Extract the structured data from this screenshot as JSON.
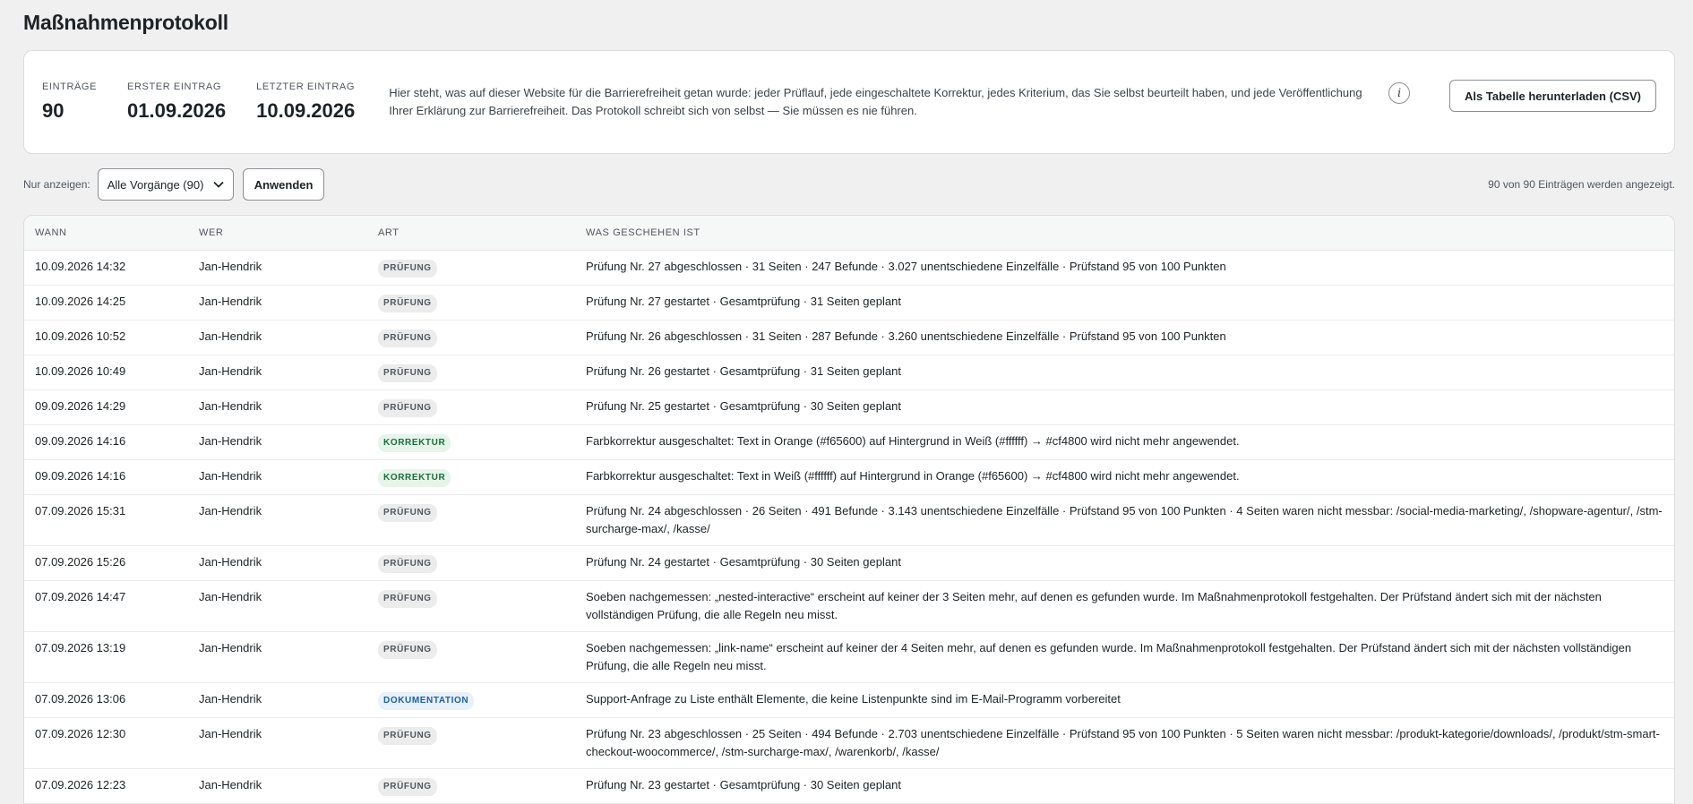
{
  "page": {
    "title": "Maßnahmenprotokoll"
  },
  "summary": {
    "stats": [
      {
        "label": "EINTRÄGE",
        "value": "90"
      },
      {
        "label": "ERSTER EINTRAG",
        "value": "01.09.2026"
      },
      {
        "label": "LETZTER EINTRAG",
        "value": "10.09.2026"
      }
    ],
    "intro": "Hier steht, was auf dieser Website für die Barrierefreiheit getan wurde: jeder Prüflauf, jede eingeschaltete Korrektur, jedes Kriterium, das Sie selbst beurteilt haben, und jede Veröffentlichung Ihrer Erklärung zur Barrierefreiheit. Das Protokoll schreibt sich von selbst — Sie müssen es nie führen.",
    "info_icon": "i",
    "csv_button": "Als Tabelle herunterladen (CSV)"
  },
  "filter": {
    "label": "Nur anzeigen:",
    "selected": "Alle Vorgänge (90)",
    "apply": "Anwenden",
    "count_note": "90 von 90 Einträgen werden angezeigt."
  },
  "table": {
    "headers": [
      "WANN",
      "WER",
      "ART",
      "WAS GESCHEHEN IST"
    ],
    "rows": [
      {
        "when": "10.09.2026 14:32",
        "who": "Jan-Hendrik",
        "type": "PRÜFUNG",
        "kind": "pruefung",
        "what": "Prüfung Nr. 27 abgeschlossen · 31 Seiten · 247 Befunde · 3.027 unentschiedene Einzelfälle · Prüfstand 95 von 100 Punkten"
      },
      {
        "when": "10.09.2026 14:25",
        "who": "Jan-Hendrik",
        "type": "PRÜFUNG",
        "kind": "pruefung",
        "what": "Prüfung Nr. 27 gestartet · Gesamtprüfung · 31 Seiten geplant"
      },
      {
        "when": "10.09.2026 10:52",
        "who": "Jan-Hendrik",
        "type": "PRÜFUNG",
        "kind": "pruefung",
        "what": "Prüfung Nr. 26 abgeschlossen · 31 Seiten · 287 Befunde · 3.260 unentschiedene Einzelfälle · Prüfstand 95 von 100 Punkten"
      },
      {
        "when": "10.09.2026 10:49",
        "who": "Jan-Hendrik",
        "type": "PRÜFUNG",
        "kind": "pruefung",
        "what": "Prüfung Nr. 26 gestartet · Gesamtprüfung · 31 Seiten geplant"
      },
      {
        "when": "09.09.2026 14:29",
        "who": "Jan-Hendrik",
        "type": "PRÜFUNG",
        "kind": "pruefung",
        "what": "Prüfung Nr. 25 gestartet · Gesamtprüfung · 30 Seiten geplant"
      },
      {
        "when": "09.09.2026 14:16",
        "who": "Jan-Hendrik",
        "type": "KORREKTUR",
        "kind": "korrektur",
        "what": "Farbkorrektur ausgeschaltet: Text in Orange (#f65600) auf Hintergrund in Weiß (#ffffff) → #cf4800 wird nicht mehr angewendet."
      },
      {
        "when": "09.09.2026 14:16",
        "who": "Jan-Hendrik",
        "type": "KORREKTUR",
        "kind": "korrektur",
        "what": "Farbkorrektur ausgeschaltet: Text in Weiß (#ffffff) auf Hintergrund in Orange (#f65600) → #cf4800 wird nicht mehr angewendet."
      },
      {
        "when": "07.09.2026 15:31",
        "who": "Jan-Hendrik",
        "type": "PRÜFUNG",
        "kind": "pruefung",
        "what": "Prüfung Nr. 24 abgeschlossen · 26 Seiten · 491 Befunde · 3.143 unentschiedene Einzelfälle · Prüfstand 95 von 100 Punkten · 4 Seiten waren nicht messbar: /social-media-marketing/, /shopware-agentur/, /stm-surcharge-max/, /kasse/"
      },
      {
        "when": "07.09.2026 15:26",
        "who": "Jan-Hendrik",
        "type": "PRÜFUNG",
        "kind": "pruefung",
        "what": "Prüfung Nr. 24 gestartet · Gesamtprüfung · 30 Seiten geplant"
      },
      {
        "when": "07.09.2026 14:47",
        "who": "Jan-Hendrik",
        "type": "PRÜFUNG",
        "kind": "pruefung",
        "what": "Soeben nachgemessen: „nested-interactive“ erscheint auf keiner der 3 Seiten mehr, auf denen es gefunden wurde. Im Maßnahmenprotokoll festgehalten. Der Prüfstand ändert sich mit der nächsten vollständigen Prüfung, die alle Regeln neu misst."
      },
      {
        "when": "07.09.2026 13:19",
        "who": "Jan-Hendrik",
        "type": "PRÜFUNG",
        "kind": "pruefung",
        "what": "Soeben nachgemessen: „link-name“ erscheint auf keiner der 4 Seiten mehr, auf denen es gefunden wurde. Im Maßnahmenprotokoll festgehalten. Der Prüfstand ändert sich mit der nächsten vollständigen Prüfung, die alle Regeln neu misst."
      },
      {
        "when": "07.09.2026 13:06",
        "who": "Jan-Hendrik",
        "type": "DOKUMENTATION",
        "kind": "doku",
        "what": "Support-Anfrage zu Liste enthält Elemente, die keine Listenpunkte sind im E-Mail-Programm vorbereitet"
      },
      {
        "when": "07.09.2026 12:30",
        "who": "Jan-Hendrik",
        "type": "PRÜFUNG",
        "kind": "pruefung",
        "what": "Prüfung Nr. 23 abgeschlossen · 25 Seiten · 494 Befunde · 2.703 unentschiedene Einzelfälle · Prüfstand 95 von 100 Punkten · 5 Seiten waren nicht messbar: /produkt-kategorie/downloads/, /produkt/stm-smart-checkout-woocommerce/, /stm-surcharge-max/, /warenkorb/, /kasse/"
      },
      {
        "when": "07.09.2026 12:23",
        "who": "Jan-Hendrik",
        "type": "PRÜFUNG",
        "kind": "pruefung",
        "what": "Prüfung Nr. 23 gestartet · Gesamtprüfung · 30 Seiten geplant"
      }
    ]
  }
}
